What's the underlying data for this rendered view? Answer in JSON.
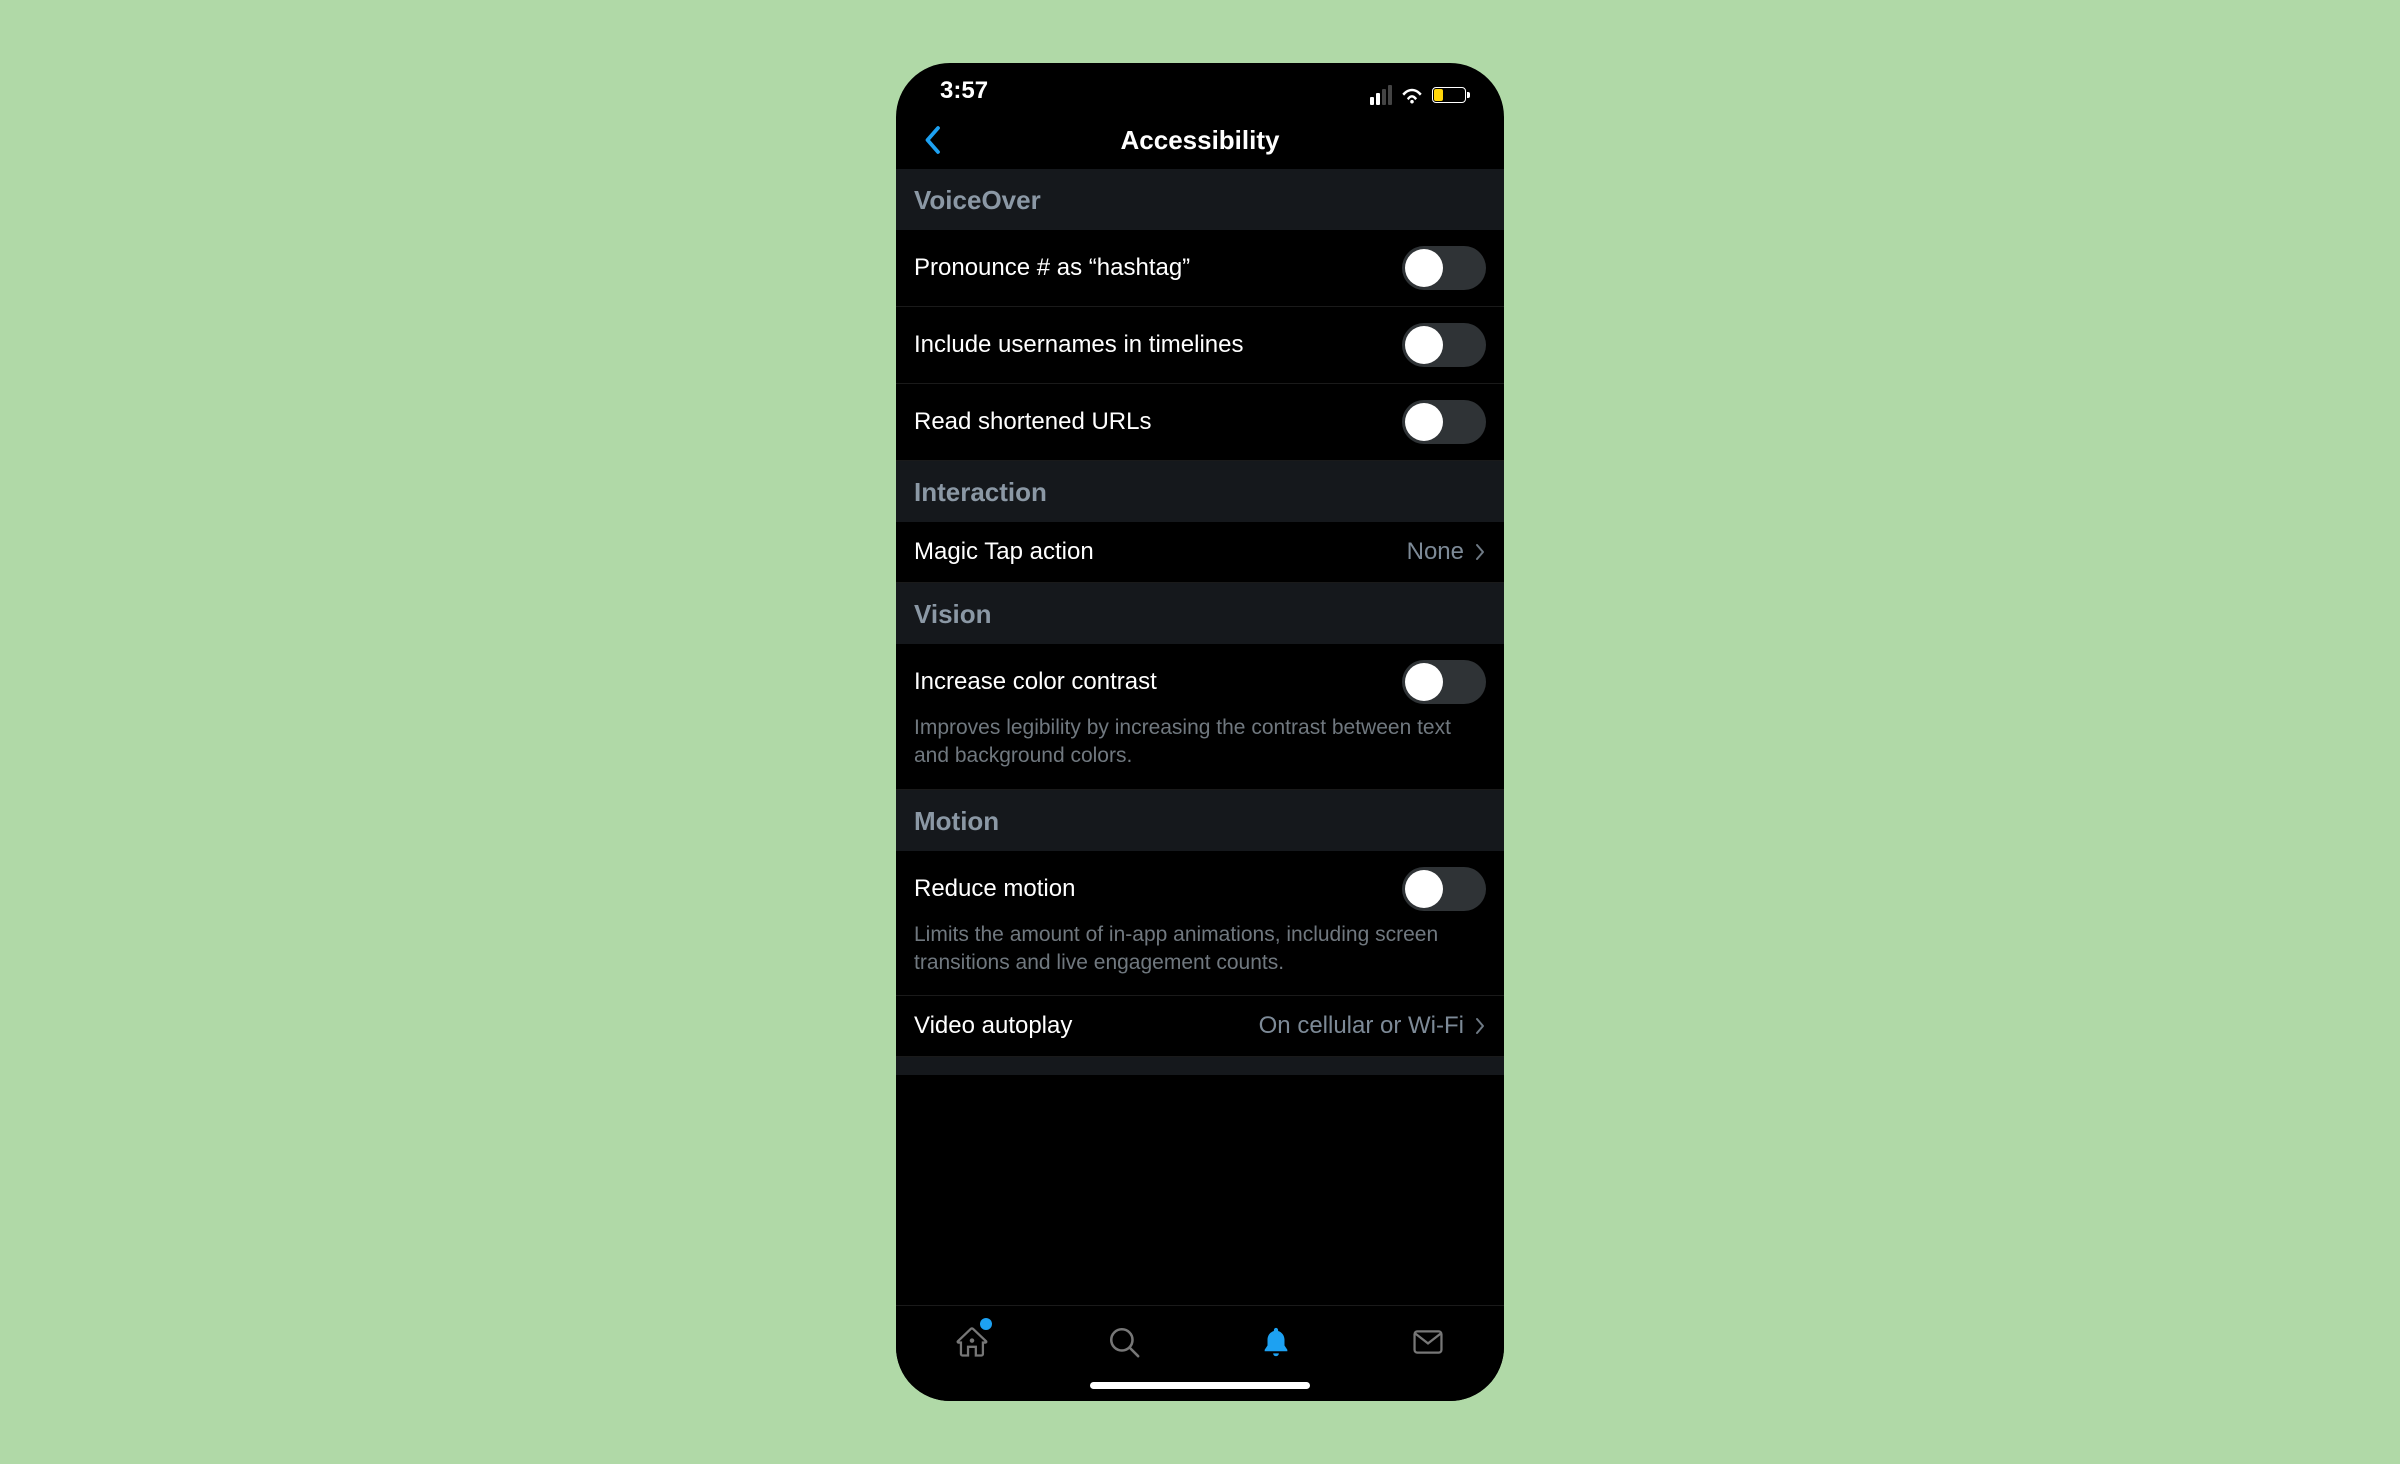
{
  "status": {
    "time": "3:57"
  },
  "header": {
    "title": "Accessibility"
  },
  "sections": {
    "voiceover": {
      "title": "VoiceOver",
      "items": {
        "pronounce": "Pronounce # as “hashtag”",
        "usernames": "Include usernames in timelines",
        "urls": "Read shortened URLs"
      }
    },
    "interaction": {
      "title": "Interaction",
      "magic_tap": {
        "label": "Magic Tap action",
        "value": "None"
      }
    },
    "vision": {
      "title": "Vision",
      "contrast": {
        "label": "Increase color contrast",
        "desc": "Improves legibility by increasing the contrast between text and background colors."
      }
    },
    "motion": {
      "title": "Motion",
      "reduce": {
        "label": "Reduce motion",
        "desc": "Limits the amount of in-app animations, including screen transitions and live engagement counts."
      },
      "autoplay": {
        "label": "Video autoplay",
        "value": "On cellular or Wi-Fi"
      }
    }
  }
}
